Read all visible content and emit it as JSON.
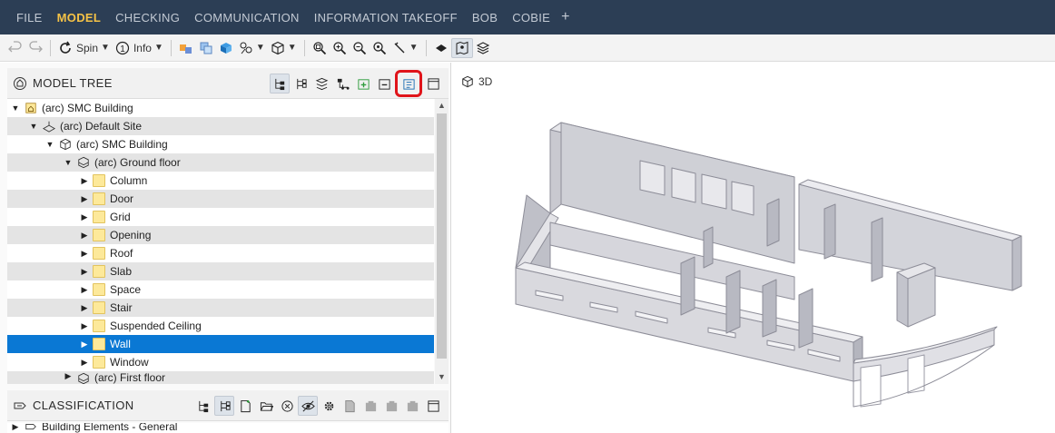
{
  "menu": {
    "items": [
      "FILE",
      "MODEL",
      "CHECKING",
      "COMMUNICATION",
      "INFORMATION TAKEOFF",
      "BOB",
      "COBIE"
    ],
    "active": "MODEL",
    "add_symbol": "+"
  },
  "toolbar": {
    "spin_label": "Spin",
    "info_label": "Info"
  },
  "model_tree": {
    "title": "MODEL TREE",
    "rows": [
      {
        "label": "(arc) SMC Building",
        "icon": "building-icon"
      },
      {
        "label": "(arc) Default Site",
        "icon": "site-icon"
      },
      {
        "label": "(arc) SMC Building",
        "icon": "cube-icon"
      },
      {
        "label": "(arc) Ground floor",
        "icon": "floor-icon"
      },
      {
        "label": "Column",
        "icon": "folder-icon"
      },
      {
        "label": "Door",
        "icon": "folder-icon"
      },
      {
        "label": "Grid",
        "icon": "folder-icon"
      },
      {
        "label": "Opening",
        "icon": "folder-icon"
      },
      {
        "label": "Roof",
        "icon": "folder-icon"
      },
      {
        "label": "Slab",
        "icon": "folder-icon"
      },
      {
        "label": "Space",
        "icon": "folder-icon"
      },
      {
        "label": "Stair",
        "icon": "folder-icon"
      },
      {
        "label": "Suspended Ceiling",
        "icon": "folder-icon"
      },
      {
        "label": "Wall",
        "icon": "folder-icon"
      },
      {
        "label": "Window",
        "icon": "folder-icon"
      },
      {
        "label": "(arc) First floor",
        "icon": "floor-icon"
      }
    ],
    "selected": "Wall"
  },
  "classification": {
    "title": "CLASSIFICATION",
    "rows": [
      {
        "label": "Building Elements - General"
      }
    ]
  },
  "view": {
    "label": "3D"
  },
  "colors": {
    "menubar": "#2c3e55",
    "menu_active": "#f5c246",
    "selection": "#0a78d4",
    "highlight_box": "#e0141a"
  }
}
